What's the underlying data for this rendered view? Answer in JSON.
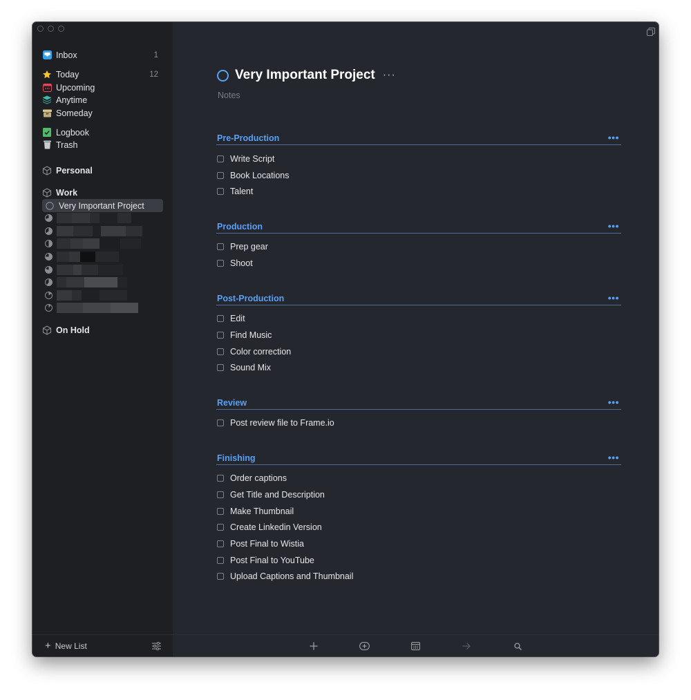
{
  "sidebar": {
    "inbox": {
      "label": "Inbox",
      "count": "1",
      "icon": "inbox-icon"
    },
    "today": {
      "label": "Today",
      "count": "12",
      "icon": "star-icon"
    },
    "upcoming": {
      "label": "Upcoming",
      "icon": "calendar-icon"
    },
    "anytime": {
      "label": "Anytime",
      "icon": "layers-icon"
    },
    "someday": {
      "label": "Someday",
      "icon": "box-icon"
    },
    "logbook": {
      "label": "Logbook",
      "icon": "logbook-icon"
    },
    "trash": {
      "label": "Trash",
      "icon": "trash-icon"
    },
    "areas": [
      {
        "label": "Personal"
      },
      {
        "label": "Work"
      },
      {
        "label": "On Hold"
      }
    ],
    "selected_project": {
      "label": "Very Important Project"
    },
    "new_list_label": "New List"
  },
  "project": {
    "title": "Very Important Project",
    "more": "···",
    "notes_placeholder": "Notes"
  },
  "sections": [
    {
      "heading": "Pre-Production",
      "tasks": [
        "Write Script",
        "Book Locations",
        "Talent"
      ]
    },
    {
      "heading": "Production",
      "tasks": [
        "Prep gear",
        "Shoot"
      ]
    },
    {
      "heading": "Post-Production",
      "tasks": [
        "Edit",
        "Find Music",
        "Color correction",
        "Sound Mix"
      ]
    },
    {
      "heading": "Review",
      "tasks": [
        "Post review file to Frame.io"
      ]
    },
    {
      "heading": "Finishing",
      "tasks": [
        "Order captions",
        "Get Title and Description",
        "Make Thumbnail",
        "Create Linkedin Version",
        "Post Final to Wistia",
        "Post Final to YouTube",
        "Upload Captions and Thumbnail"
      ]
    }
  ],
  "heading_more": "•••",
  "colors": {
    "accent": "#5aa0f5",
    "background": "#24272d",
    "sidebar": "#1d1f22",
    "star": "#f7c531",
    "upcoming": "#e8455c",
    "anytime": "#3fb9a6",
    "someday": "#d9c48d",
    "logbook": "#52b86a"
  }
}
